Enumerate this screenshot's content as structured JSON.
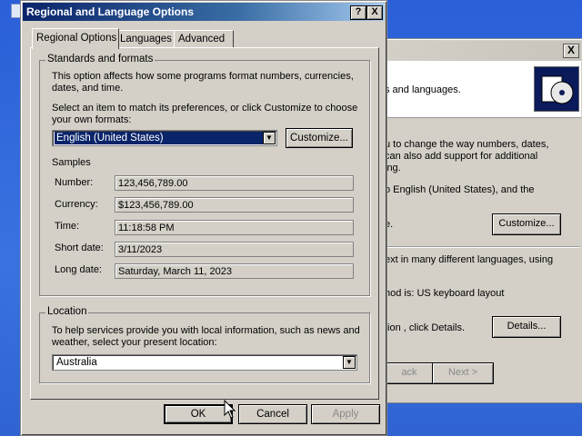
{
  "dialog": {
    "title": "Regional and Language Options",
    "help_btn": "?",
    "close_btn": "X",
    "tabs": [
      {
        "label": "Regional Options",
        "active": true
      },
      {
        "label": "Languages",
        "active": false
      },
      {
        "label": "Advanced",
        "active": false
      }
    ],
    "standards": {
      "legend": "Standards and formats",
      "desc1": "This option affects how some programs format numbers, currencies,",
      "desc2": "dates, and time.",
      "select1": "Select an item to match its preferences, or click Customize to choose",
      "select2": "your own formats:",
      "format_value": "English (United States)",
      "customize": "Customize...",
      "samples_label": "Samples",
      "samples": [
        {
          "label": "Number:",
          "value": "123,456,789.00"
        },
        {
          "label": "Currency:",
          "value": "$123,456,789.00"
        },
        {
          "label": "Time:",
          "value": "11:18:58 PM"
        },
        {
          "label": "Short date:",
          "value": "3/11/2023"
        },
        {
          "label": "Long date:",
          "value": "Saturday, March 11, 2023"
        }
      ]
    },
    "location": {
      "legend": "Location",
      "desc1": "To help services provide you with local information, such as news and",
      "desc2": "weather, select your present location:",
      "value": "Australia"
    },
    "buttons": {
      "ok": "OK",
      "cancel": "Cancel",
      "apply": "Apply"
    }
  },
  "background_window": {
    "close_btn": "X",
    "line1": "s and languages.",
    "line2": "u to change the way numbers, dates,",
    "line3": "can also add support for additional",
    "line4": "ing.",
    "line5": "o English (United States), and the",
    "line6": "e.",
    "customize": "Customize...",
    "line7": "ext in many different languages, using",
    "line8": "hod is: US keyboard layout",
    "line9": "tion , click Details.",
    "details": "Details...",
    "back": "ack",
    "next": "Next >"
  }
}
